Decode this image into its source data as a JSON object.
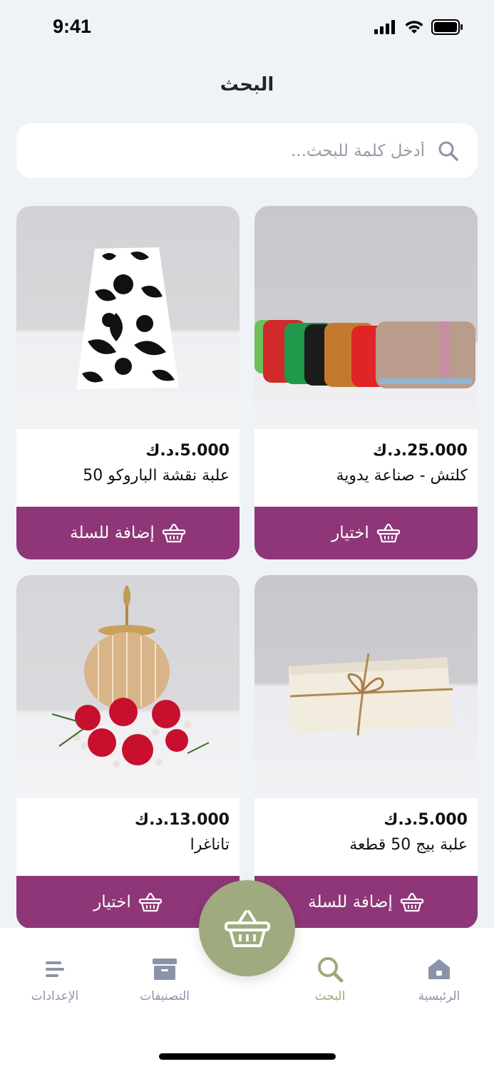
{
  "status": {
    "time": "9:41"
  },
  "header": {
    "title": "البحث"
  },
  "search": {
    "placeholder": "أدخل كلمة للبحث..."
  },
  "products": [
    {
      "price": "25.000.د.ك",
      "name": "كلتش - صناعة يدوية",
      "button": "اختيار"
    },
    {
      "price": "5.000.د.ك",
      "name": "علبة نقشة الباروكو 50",
      "button": "إضافة للسلة"
    },
    {
      "price": "5.000.د.ك",
      "name": "علبة بيج 50 قطعة",
      "button": "إضافة للسلة"
    },
    {
      "price": "13.000.د.ك",
      "name": "تاناغرا",
      "button": "اختيار"
    }
  ],
  "nav": {
    "home": "الرئيسية",
    "search": "البحث",
    "categories": "التصنيفات",
    "settings": "الإعدادات"
  },
  "colors": {
    "accent": "#8e3678",
    "nav_active": "#9caa78",
    "fab": "#9fab7e"
  }
}
